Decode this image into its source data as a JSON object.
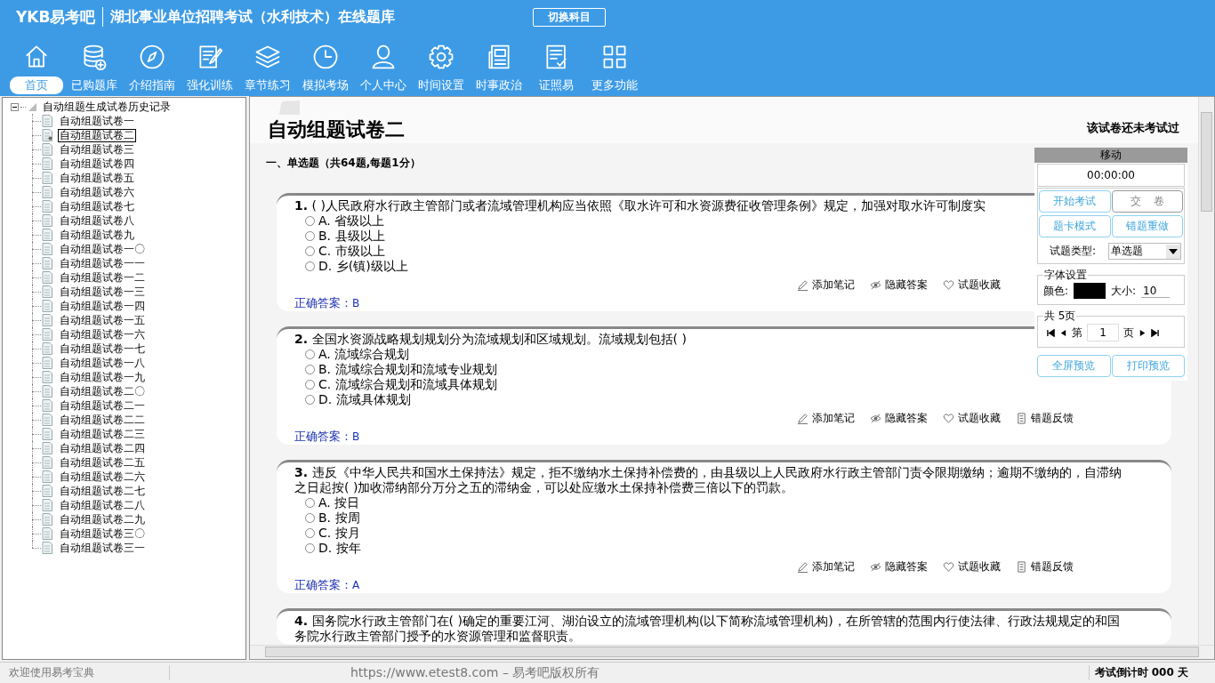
{
  "header": {
    "logo": "YKB易考吧",
    "title": "湖北事业单位招聘考试（水利技术）在线题库",
    "switch_button": "切换科目"
  },
  "toolbar": [
    {
      "label": "首页",
      "selected": true
    },
    {
      "label": "已购题库",
      "selected": false
    },
    {
      "label": "介绍指南",
      "selected": false
    },
    {
      "label": "强化训练",
      "selected": false
    },
    {
      "label": "章节练习",
      "selected": false
    },
    {
      "label": "模拟考场",
      "selected": false
    },
    {
      "label": "个人中心",
      "selected": false
    },
    {
      "label": "时间设置",
      "selected": false
    },
    {
      "label": "时事政治",
      "selected": false
    },
    {
      "label": "证照易",
      "selected": false
    },
    {
      "label": "更多功能",
      "selected": false
    }
  ],
  "tree": {
    "label": "自动组题生成试卷历史记录",
    "expanded": true,
    "children": [
      {
        "label": "自动组题试卷一",
        "selected": false
      },
      {
        "label": "自动组题试卷二",
        "selected": true
      },
      {
        "label": "自动组题试卷三",
        "selected": false
      },
      {
        "label": "自动组题试卷四",
        "selected": false
      },
      {
        "label": "自动组题试卷五",
        "selected": false
      },
      {
        "label": "自动组题试卷六",
        "selected": false
      },
      {
        "label": "自动组题试卷七",
        "selected": false
      },
      {
        "label": "自动组题试卷八",
        "selected": false
      },
      {
        "label": "自动组题试卷九",
        "selected": false
      },
      {
        "label": "自动组题试卷一〇",
        "selected": false
      },
      {
        "label": "自动组题试卷一一",
        "selected": false
      },
      {
        "label": "自动组题试卷一二",
        "selected": false
      },
      {
        "label": "自动组题试卷一三",
        "selected": false
      },
      {
        "label": "自动组题试卷一四",
        "selected": false
      },
      {
        "label": "自动组题试卷一五",
        "selected": false
      },
      {
        "label": "自动组题试卷一六",
        "selected": false
      },
      {
        "label": "自动组题试卷一七",
        "selected": false
      },
      {
        "label": "自动组题试卷一八",
        "selected": false
      },
      {
        "label": "自动组题试卷一九",
        "selected": false
      },
      {
        "label": "自动组题试卷二〇",
        "selected": false
      },
      {
        "label": "自动组题试卷二一",
        "selected": false
      },
      {
        "label": "自动组题试卷二二",
        "selected": false
      },
      {
        "label": "自动组题试卷二三",
        "selected": false
      },
      {
        "label": "自动组题试卷二四",
        "selected": false
      },
      {
        "label": "自动组题试卷二五",
        "selected": false
      },
      {
        "label": "自动组题试卷二六",
        "selected": false
      },
      {
        "label": "自动组题试卷二七",
        "selected": false
      },
      {
        "label": "自动组题试卷二八",
        "selected": false
      },
      {
        "label": "自动组题试卷二九",
        "selected": false
      },
      {
        "label": "自动组题试卷三〇",
        "selected": false
      },
      {
        "label": "自动组题试卷三一",
        "selected": false
      }
    ]
  },
  "paper": {
    "title": "自动组题试卷二",
    "status": "该试卷还未考试过",
    "section": "一、单选题（共64题,每题1分）"
  },
  "questions": [
    {
      "number": "1.",
      "text": "( )人民政府水行政主管部门或者流域管理机构应当依照《取水许可和水资源费征收管理条例》规定，加强对取水许可制度实",
      "options": [
        {
          "label": "A. 省级以上",
          "selected": false
        },
        {
          "label": "B. 县级以上",
          "selected": false
        },
        {
          "label": "C. 市级以上",
          "selected": false
        },
        {
          "label": "D. 乡(镇)级以上",
          "selected": false
        }
      ],
      "actions": [
        "添加笔记",
        "隐藏答案",
        "试题收藏"
      ],
      "answer_label": "正确答案：",
      "answer": "B"
    },
    {
      "number": "2.",
      "text": "全国水资源战略规划规划分为流域规划和区域规划。流域规划包括( )",
      "options": [
        {
          "label": "A. 流域综合规划",
          "selected": false
        },
        {
          "label": "B. 流域综合规划和流域专业规划",
          "selected": false
        },
        {
          "label": "C. 流域综合规划和流域具体规划",
          "selected": false
        },
        {
          "label": "D. 流域具体规划",
          "selected": false
        }
      ],
      "actions": [
        "添加笔记",
        "隐藏答案",
        "试题收藏",
        "错题反馈"
      ],
      "answer_label": "正确答案：",
      "answer": "B"
    },
    {
      "number": "3.",
      "text": "违反《中华人民共和国水土保持法》规定，拒不缴纳水土保持补偿费的，由县级以上人民政府水行政主管部门责令限期缴纳；逾期不缴纳的，自滞纳之日起按( )加收滞纳部分万分之五的滞纳金，可以处应缴水土保持补偿费三倍以下的罚款。",
      "options": [
        {
          "label": "A. 按日",
          "selected": false
        },
        {
          "label": "B. 按周",
          "selected": false
        },
        {
          "label": "C. 按月",
          "selected": false
        },
        {
          "label": "D. 按年",
          "selected": false
        }
      ],
      "actions": [
        "添加笔记",
        "隐藏答案",
        "试题收藏",
        "错题反馈"
      ],
      "answer_label": "正确答案：",
      "answer": "A"
    },
    {
      "number": "4.",
      "text": "国务院水行政主管部门在( )确定的重要江河、湖泊设立的流域管理机构(以下简称流域管理机构)，在所管辖的范围内行使法律、行政法规规定的和国务院水行政主管部门授予的水资源管理和监督职责。"
    }
  ],
  "side_panel": {
    "move_label": "移动",
    "timer": "00:00:00",
    "buttons": [
      {
        "label": "开始考试",
        "disabled": false
      },
      {
        "label": "交卷",
        "disabled": true
      },
      {
        "label": "题卡模式",
        "disabled": false
      },
      {
        "label": "错题重做",
        "disabled": false
      }
    ],
    "type_label": "试题类型:",
    "type_value": "单选题",
    "font": {
      "legend": "字体设置",
      "color_label": "颜色:",
      "color": "#000000",
      "size_label": "大小:",
      "size": "10"
    },
    "pages": {
      "legend": "共 5页",
      "prefix": "第",
      "page": "1",
      "suffix": "页"
    },
    "preview_buttons": [
      "全屏预览",
      "打印预览"
    ]
  },
  "status_bar": {
    "welcome": "欢迎使用易考宝典",
    "copyright": "https://www.etest8.com – 易考吧版权所有",
    "countdown": "考试倒计时 000 天"
  }
}
